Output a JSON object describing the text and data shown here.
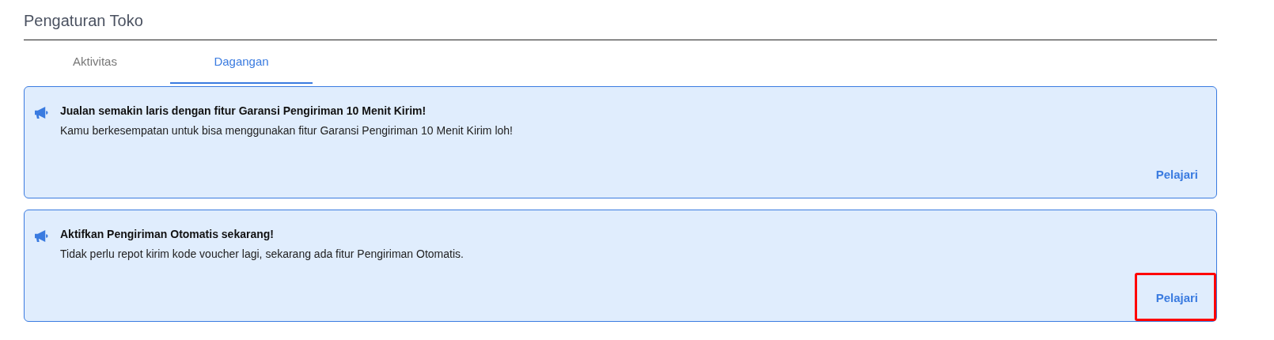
{
  "page_title": "Pengaturan Toko",
  "tabs": [
    {
      "label": "Aktivitas",
      "selected": false
    },
    {
      "label": "Dagangan",
      "selected": true
    }
  ],
  "announcements": [
    {
      "title": "Jualan semakin laris dengan fitur Garansi Pengiriman 10 Menit Kirim!",
      "body": "Kamu berkesempatan untuk bisa menggunakan fitur Garansi Pengiriman 10 Menit Kirim loh!",
      "action": "Pelajari",
      "highlighted": false
    },
    {
      "title": "Aktifkan Pengiriman Otomatis sekarang!",
      "body": "Tidak perlu repot kirim kode voucher lagi, sekarang ada fitur Pengiriman Otomatis.",
      "action": "Pelajari",
      "highlighted": true
    }
  ]
}
